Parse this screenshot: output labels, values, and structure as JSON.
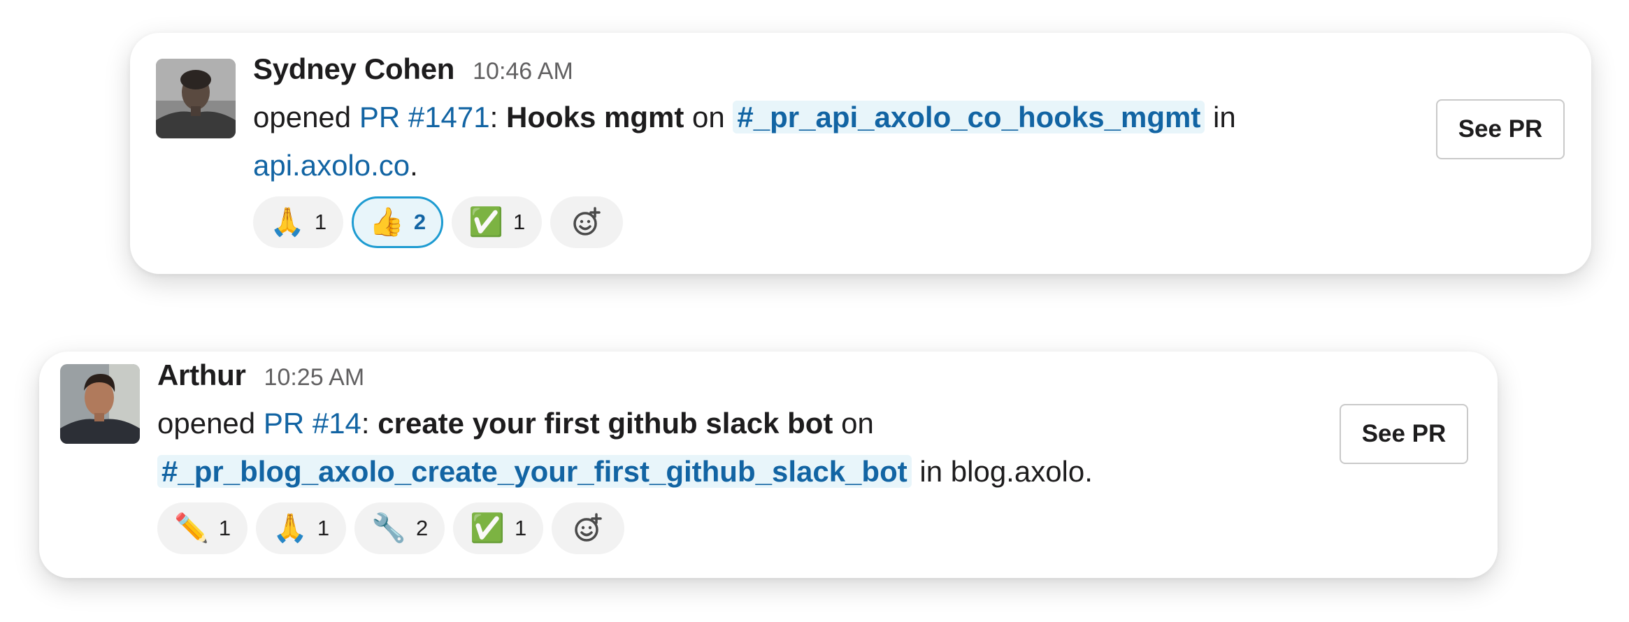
{
  "messages": [
    {
      "author": "Sydney Cohen",
      "time": "10:46 AM",
      "action": "opened",
      "pr_link": "PR #1471",
      "colon": ":",
      "pr_title": "Hooks mgmt",
      "on_word": "on",
      "channel": "#_pr_api_axolo_co_hooks_mgmt",
      "in_word": "in",
      "repo": "api.axolo.co",
      "trailing": ".",
      "reactions": [
        {
          "emoji": "🙏",
          "icon": "folded-hands-icon",
          "count": "1",
          "active": false
        },
        {
          "emoji": "👍",
          "icon": "thumbs-up-icon",
          "count": "2",
          "active": true
        },
        {
          "emoji": "✅",
          "icon": "check-mark-icon",
          "count": "1",
          "active": false
        }
      ],
      "button": "See PR"
    },
    {
      "author": "Arthur",
      "time": "10:25 AM",
      "action": "opened",
      "pr_link": "PR #14",
      "colon": ":",
      "pr_title": "create your first github slack bot",
      "on_word": "on",
      "channel": "#_pr_blog_axolo_create_your_first_github_slack_bot",
      "in_word": "in",
      "repo": "blog.axolo.",
      "trailing": "",
      "reactions": [
        {
          "emoji": "✏️",
          "icon": "pencil-icon",
          "count": "1",
          "active": false
        },
        {
          "emoji": "🙏",
          "icon": "folded-hands-icon",
          "count": "1",
          "active": false
        },
        {
          "emoji": "🔧",
          "icon": "wrench-icon",
          "count": "2",
          "active": false
        },
        {
          "emoji": "✅",
          "icon": "check-mark-icon",
          "count": "1",
          "active": false
        }
      ],
      "button": "See PR"
    }
  ],
  "colors": {
    "link": "#1264a3",
    "channel_bg": "#e8f5fa",
    "active_reaction_border": "#1d9bd1",
    "reaction_bg": "#f2f2f2"
  }
}
